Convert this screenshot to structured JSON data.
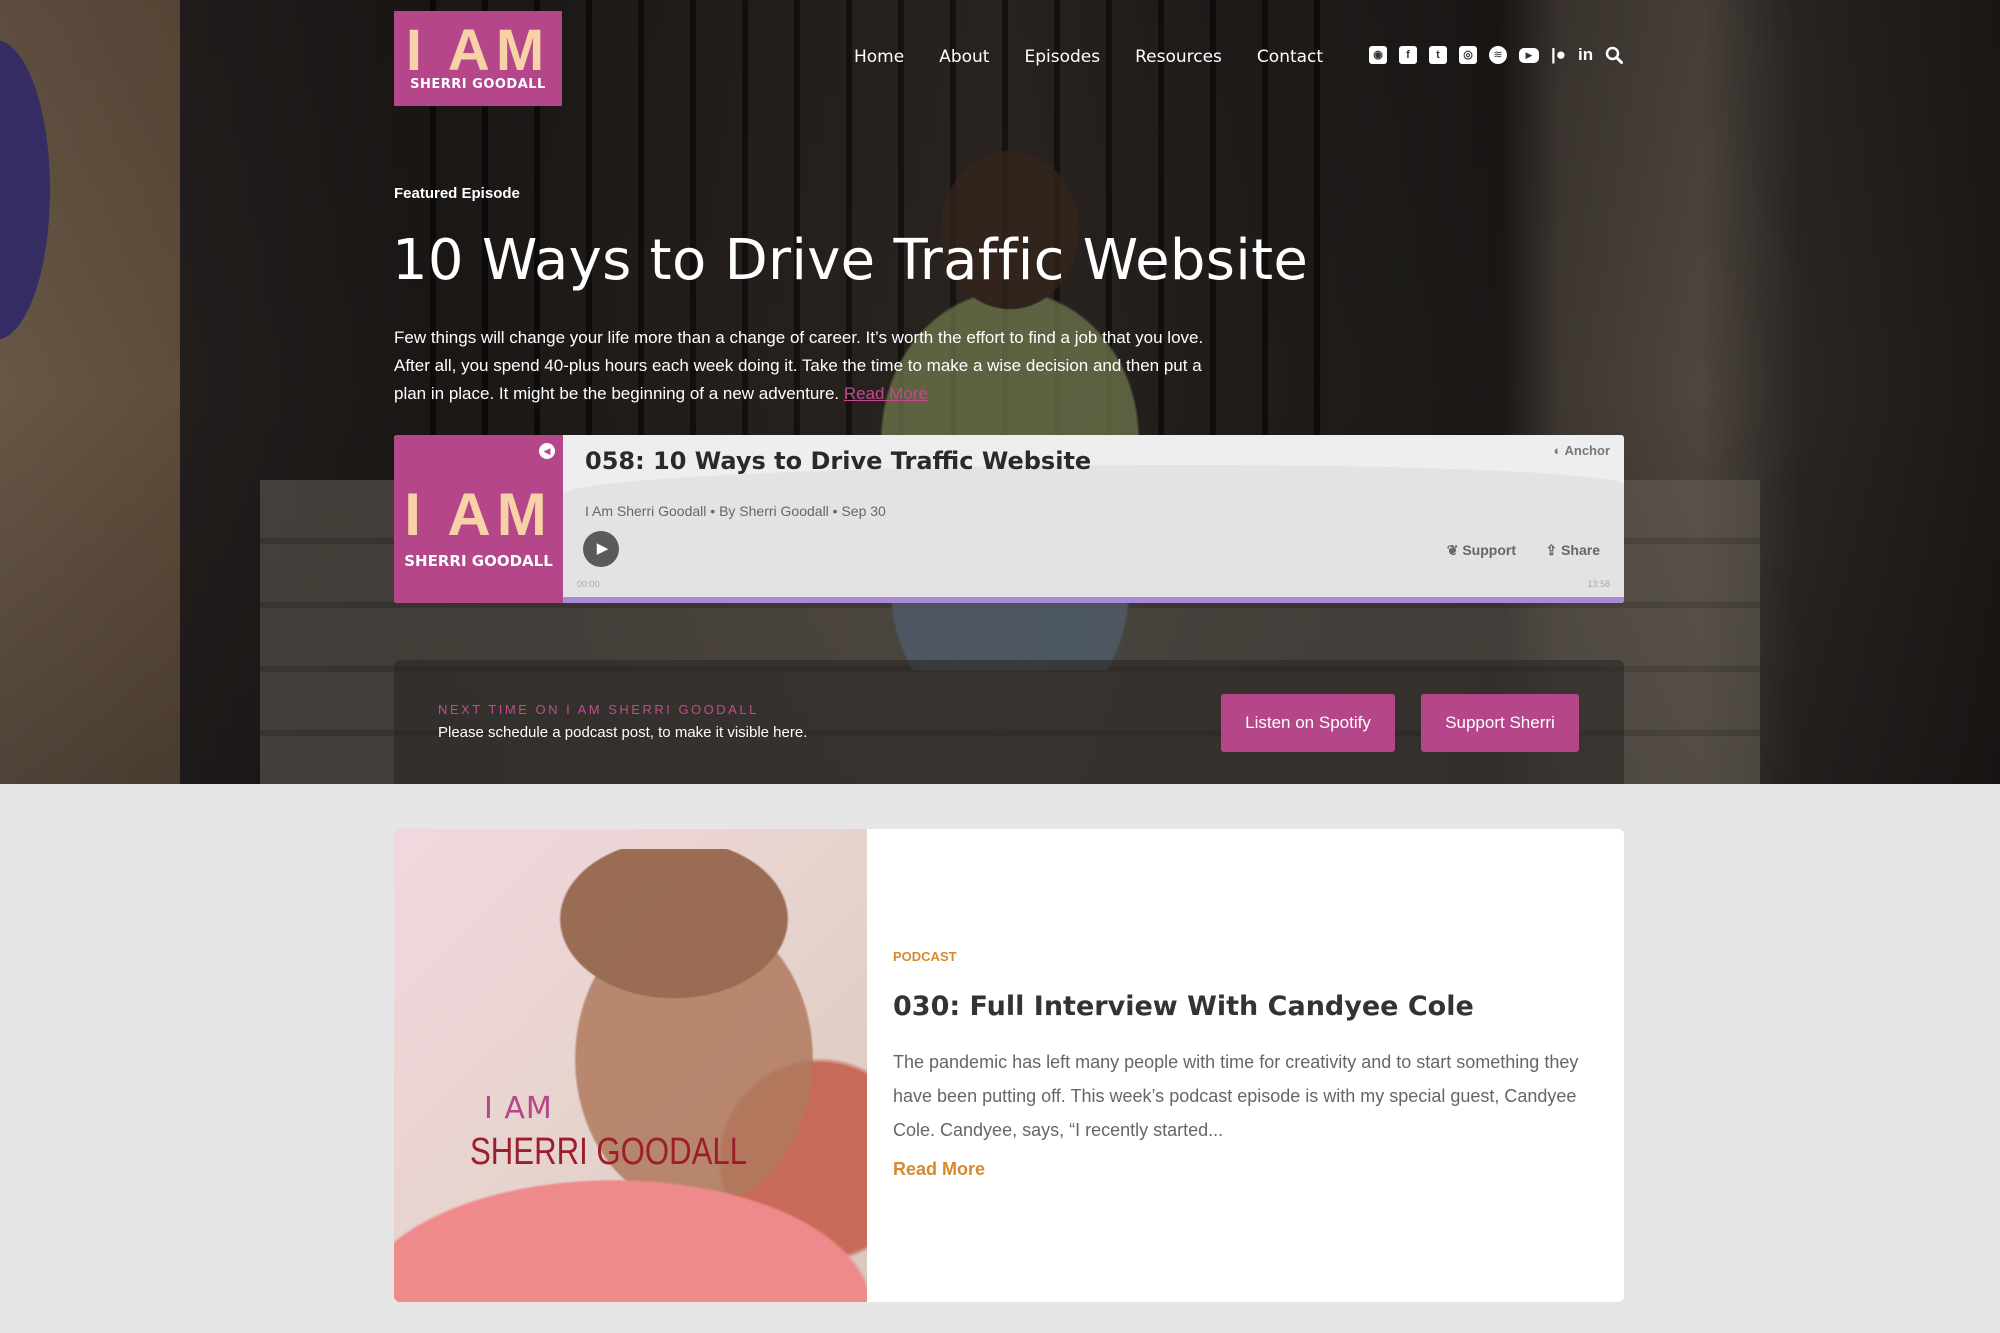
{
  "header": {
    "logo_big": "I AM",
    "logo_small": "SHERRI GOODALL",
    "nav": [
      "Home",
      "About",
      "Episodes",
      "Resources",
      "Contact"
    ]
  },
  "featured": {
    "label": "Featured Episode",
    "title": "10 Ways to Drive Traffic Website",
    "excerpt": "Few things will change your life more than a change of career. It’s worth the effort to find a job that you love. After all, you spend 40-plus hours each week doing it. Take the time to make a wise decision and then put a plan in place. It might be the beginning of a new adventure.",
    "read_more": "Read More"
  },
  "player": {
    "art_big": "I AM",
    "art_small": "SHERRI GOODALL",
    "title": "058: 10 Ways to Drive Traffic Website",
    "provider": "Anchor",
    "meta": "I Am Sherri Goodall • By Sherri Goodall • Sep 30",
    "support": "Support",
    "share": "Share",
    "time_start": "00:00",
    "time_end": "13:58"
  },
  "next": {
    "label": "NEXT TIME ON I AM SHERRI GOODALL",
    "text": "Please schedule a podcast post, to make it visible here.",
    "btn_spotify": "Listen on Spotify",
    "btn_support": "Support Sherri"
  },
  "post": {
    "photo_line1": "I AM",
    "photo_line2": "SHERRI GOODALL",
    "category": "PODCAST",
    "title": "030: Full Interview With Candyee Cole",
    "excerpt": "The pandemic has left many people with time for creativity and to start something they have been putting off. This week’s podcast episode is with my special guest, Candyee Cole. Candyee, says, “I recently started...",
    "read_more": "Read More"
  },
  "colors": {
    "brand_pink": "#b5468a",
    "accent_orange": "#d68a2e",
    "progress_purple": "#a98ad8"
  },
  "social_icons": [
    "rss-icon",
    "facebook-icon",
    "twitter-icon",
    "instagram-icon",
    "spotify-icon",
    "youtube-icon",
    "patreon-icon",
    "linkedin-icon"
  ]
}
